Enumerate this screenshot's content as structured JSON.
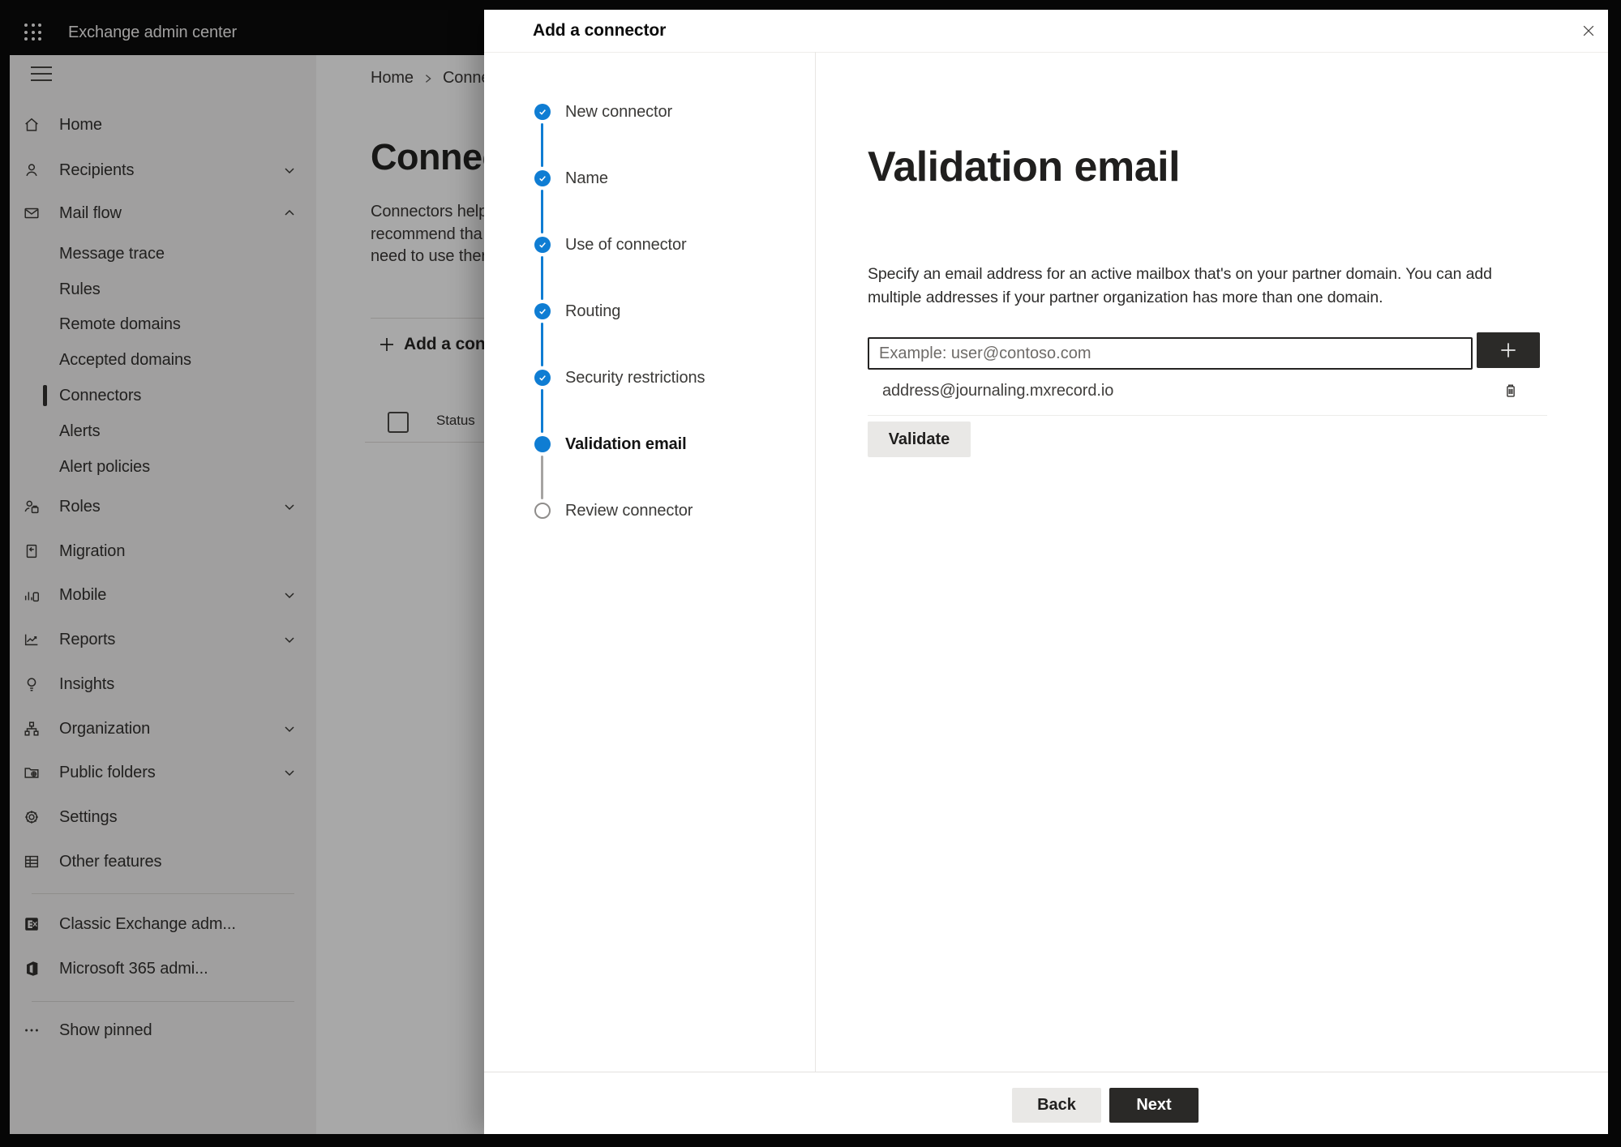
{
  "topbar": {
    "title": "Exchange admin center"
  },
  "sidebar": {
    "items": [
      {
        "label": "Home"
      },
      {
        "label": "Recipients"
      },
      {
        "label": "Mail flow"
      },
      {
        "label": "Message trace"
      },
      {
        "label": "Rules"
      },
      {
        "label": "Remote domains"
      },
      {
        "label": "Accepted domains"
      },
      {
        "label": "Connectors"
      },
      {
        "label": "Alerts"
      },
      {
        "label": "Alert policies"
      },
      {
        "label": "Roles"
      },
      {
        "label": "Migration"
      },
      {
        "label": "Mobile"
      },
      {
        "label": "Reports"
      },
      {
        "label": "Insights"
      },
      {
        "label": "Organization"
      },
      {
        "label": "Public folders"
      },
      {
        "label": "Settings"
      },
      {
        "label": "Other features"
      },
      {
        "label": "Classic Exchange adm..."
      },
      {
        "label": "Microsoft 365 admi..."
      },
      {
        "label": "Show pinned"
      }
    ]
  },
  "background_page": {
    "breadcrumb": {
      "home": "Home",
      "current_fragment": "Conne"
    },
    "heading_fragment": "Connec",
    "intro_lines": [
      "Connectors help",
      "recommend tha",
      "need to use ther"
    ],
    "add_connector_fragment": "Add a conn",
    "status_column": "Status"
  },
  "panel": {
    "title": "Add a connector",
    "steps": [
      {
        "label": "New connector",
        "state": "complete"
      },
      {
        "label": "Name",
        "state": "complete"
      },
      {
        "label": "Use of connector",
        "state": "complete"
      },
      {
        "label": "Routing",
        "state": "complete"
      },
      {
        "label": "Security restrictions",
        "state": "complete"
      },
      {
        "label": "Validation email",
        "state": "current"
      },
      {
        "label": "Review connector",
        "state": "upcoming"
      }
    ],
    "content": {
      "heading": "Validation email",
      "description_lines": [
        "Specify an email address for an active mailbox that's on your partner domain. You can add",
        "multiple addresses if your partner organization has more than one domain."
      ],
      "email_input_placeholder": "Example: user@contoso.com",
      "addresses": [
        {
          "email": "address@journaling.mxrecord.io"
        }
      ],
      "validate_label": "Validate"
    },
    "footer": {
      "back_label": "Back",
      "next_label": "Next"
    }
  },
  "colors": {
    "accent_blue": "#0f7dd3",
    "dark_button": "#2b2a28",
    "sidebar_bg": "#f3f2f1",
    "topbar_bg": "#0c0c0b",
    "overlay": "rgba(0,0,0,0.34)"
  }
}
